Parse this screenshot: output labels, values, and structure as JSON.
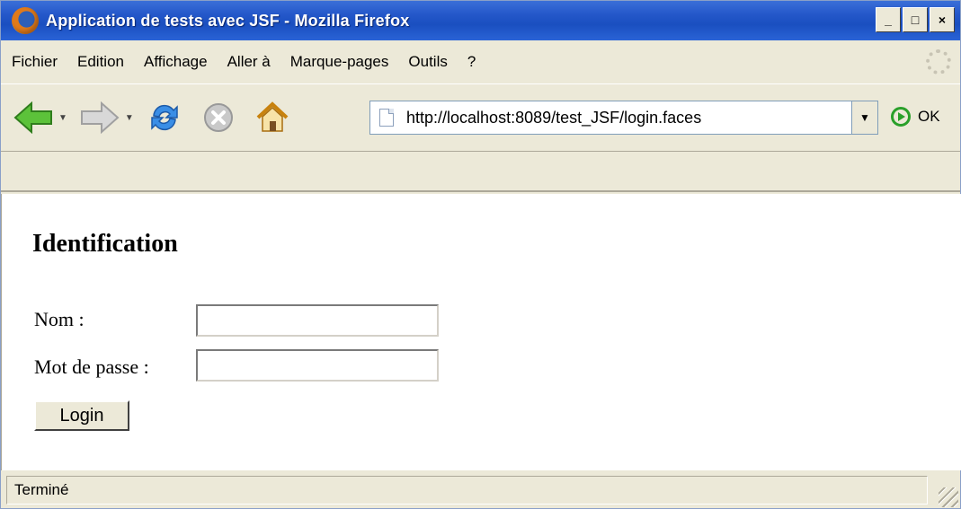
{
  "window": {
    "title": "Application de tests avec JSF - Mozilla Firefox"
  },
  "window_buttons": {
    "minimize": "_",
    "maximize": "□",
    "close": "×"
  },
  "menu": {
    "items": [
      {
        "label": "Fichier"
      },
      {
        "label": "Edition"
      },
      {
        "label": "Affichage"
      },
      {
        "label": "Aller à"
      },
      {
        "label": "Marque-pages"
      },
      {
        "label": "Outils"
      },
      {
        "label": "?"
      }
    ]
  },
  "navigation": {
    "url": "http://localhost:8089/test_JSF/login.faces",
    "go_label": "OK"
  },
  "page": {
    "heading": "Identification",
    "name_label": "Nom :",
    "name_value": "",
    "password_label": "Mot de passe :",
    "password_value": "",
    "login_button": "Login"
  },
  "status": {
    "text": "Terminé"
  },
  "icons": [
    "firefox-logo-icon",
    "back-arrow-icon",
    "forward-arrow-icon",
    "reload-icon",
    "stop-icon",
    "home-icon",
    "page-icon",
    "go-icon",
    "throbber-icon",
    "resize-grip-icon"
  ]
}
